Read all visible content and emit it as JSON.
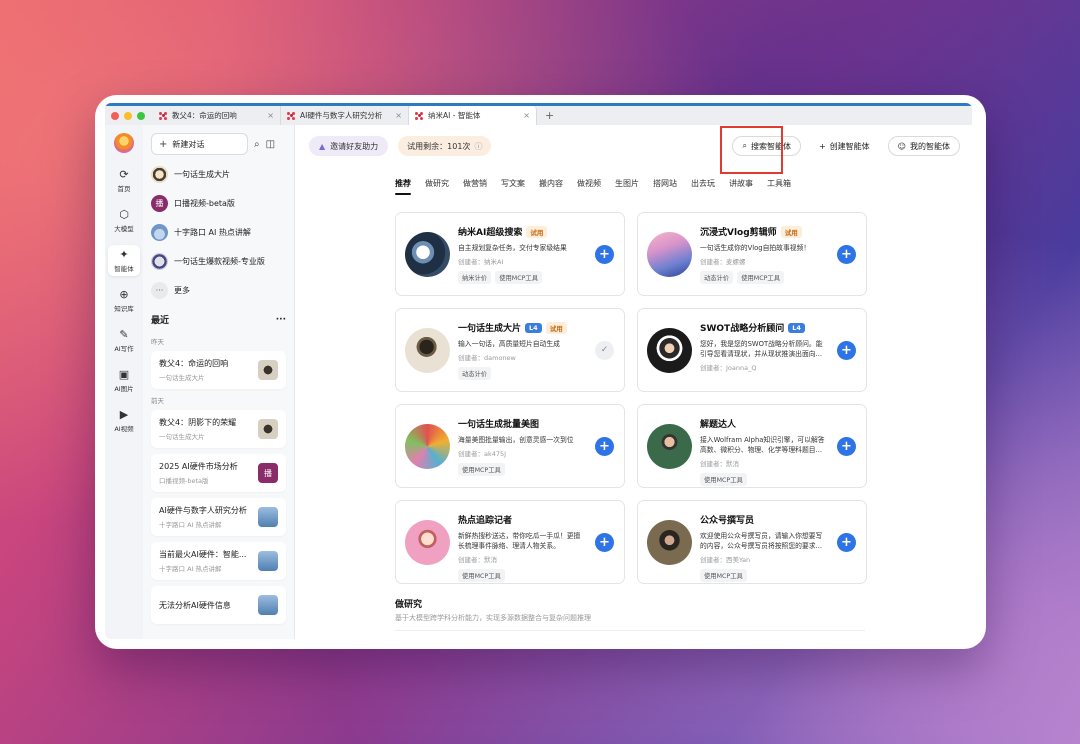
{
  "tabs": [
    {
      "label": "教父4：命运的回响",
      "close": "×"
    },
    {
      "label": "AI硬件与数字人研究分析",
      "close": "×"
    },
    {
      "label": "纳米AI - 智能体",
      "close": "×"
    }
  ],
  "new_tab": "+",
  "rail": [
    {
      "icon": "⟳",
      "label": "首页"
    },
    {
      "icon": "⬡",
      "label": "大模型"
    },
    {
      "icon": "✦",
      "label": "智能体"
    },
    {
      "icon": "⊕",
      "label": "知识库"
    },
    {
      "icon": "✎",
      "label": "AI写作"
    },
    {
      "icon": "▣",
      "label": "AI图片"
    },
    {
      "icon": "▶",
      "label": "AI视频"
    }
  ],
  "sidebar": {
    "new_chat": "新建对话",
    "agents": [
      {
        "label": "一句话生成大片"
      },
      {
        "label": "口播视频-beta版",
        "badge": "播"
      },
      {
        "label": "十字路口 AI 热点讲解"
      },
      {
        "label": "一句话生爆款视频-专业版"
      },
      {
        "label": "更多",
        "badge": "···"
      }
    ],
    "recent_title": "最近",
    "recent_more": "···",
    "groups": [
      {
        "day": "昨天",
        "items": [
          {
            "title": "教父4：命运的回响",
            "sub": "一句话生成大片"
          }
        ]
      },
      {
        "day": "前天",
        "items": [
          {
            "title": "教父4：阴影下的荣耀",
            "sub": "一句话生成大片"
          },
          {
            "title": "2025 AI硬件市场分析",
            "sub": "口播视频-beta版",
            "badge": "播"
          },
          {
            "title": "AI硬件与数字人研究分析",
            "sub": "十字路口 AI 热点讲解"
          },
          {
            "title": "当前最火AI硬件：智能...",
            "sub": "十字路口 AI 热点讲解"
          },
          {
            "title": "无法分析AI硬件信息",
            "sub": ""
          }
        ]
      }
    ]
  },
  "topbar": {
    "invite": "邀请好友助力",
    "trial": "试用剩余：101次",
    "search_agent": "搜索智能体",
    "create_agent": "创建智能体",
    "my_agent": "我的智能体"
  },
  "categories": [
    "推荐",
    "做研究",
    "做营销",
    "写文案",
    "搬内容",
    "做视频",
    "生图片",
    "搭网站",
    "出去玩",
    "讲故事",
    "工具箱"
  ],
  "cards": [
    {
      "title": "纳米AI超级搜索",
      "tag": "试用",
      "level": "",
      "desc": "自主规划复杂任务，交付专家级结果",
      "creator": "创建者：纳米AI",
      "chips": [
        "纳米计价",
        "使用MCP工具"
      ],
      "action": "+"
    },
    {
      "title": "沉浸式Vlog剪辑师",
      "tag": "试用",
      "level": "",
      "desc": "一句话生成你的Vlog自拍故事视频！",
      "creator": "创建者：麦螺螺",
      "chips": [
        "动态计价",
        "使用MCP工具"
      ],
      "action": "+"
    },
    {
      "title": "一句话生成大片",
      "tag": "试用",
      "level": "L4",
      "desc": "输入一句话，高质量短片自动生成",
      "creator": "创建者：damonew",
      "chips": [
        "动态计价"
      ],
      "action": "✓"
    },
    {
      "title": "SWOT战略分析顾问",
      "tag": "",
      "level": "L4",
      "desc": "您好，我是您的SWOT战略分析顾问。能引导您看清现状，并从现状推演出面向...",
      "creator": "创建者：Joanna_Q",
      "chips": [],
      "action": "+"
    },
    {
      "title": "一句话生成批量美图",
      "tag": "",
      "level": "",
      "desc": "海量美图批量输出，创意灵感一次到位",
      "creator": "创建者：ak475J",
      "chips": [
        "使用MCP工具"
      ],
      "action": "+"
    },
    {
      "title": "解题达人",
      "tag": "",
      "level": "",
      "desc": "接入Wolfram Alpha知识引擎，可以解答高数、微积分、物理、化学等理科题目...",
      "creator": "创建者：默消",
      "chips": [
        "使用MCP工具"
      ],
      "action": "+"
    },
    {
      "title": "热点追踪记者",
      "tag": "",
      "level": "",
      "desc": "新鲜热搜秒送达，带你吃瓜一手瓜！更擅长梳理事件脉络、理清人物关系。",
      "creator": "创建者：默消",
      "chips": [
        "使用MCP工具"
      ],
      "action": "+"
    },
    {
      "title": "公众号撰写员",
      "tag": "",
      "level": "",
      "desc": "欢迎使用公众号撰写员，请输入你想要写的内容，公众号撰写员将按照您的要求...",
      "creator": "创建者：西美Yan",
      "chips": [
        "使用MCP工具"
      ],
      "action": "+"
    }
  ],
  "section": {
    "title": "做研究",
    "desc": "基于大模型跨学科分析能力，实现多源数据整合与复杂问题推理"
  },
  "colors": {
    "accent": "#2f74e6",
    "highlight": "#e23a2e",
    "trial_tag": "#c16a1a",
    "level_tag": "#3b7ddd"
  }
}
